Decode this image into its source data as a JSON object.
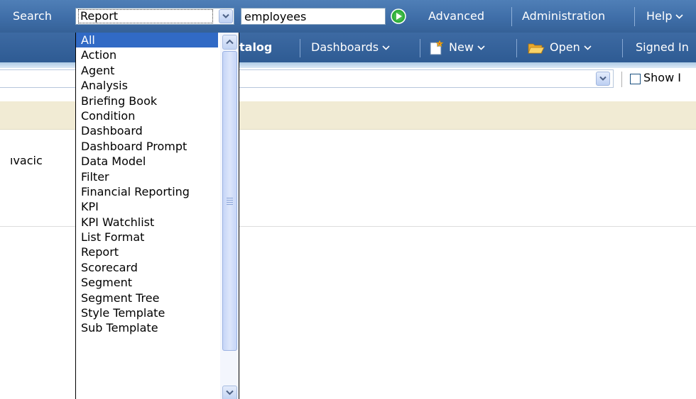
{
  "top_bar": {
    "search_label": "Search",
    "search_type_value": "Report",
    "search_input_value": "employees",
    "search_input_placeholder": "",
    "advanced_label": "Advanced",
    "administration_label": "Administration",
    "help_label": "Help"
  },
  "nav_bar": {
    "catalog_label": "talog",
    "dashboards_label": "Dashboards",
    "new_label": "New",
    "open_label": "Open",
    "signed_in_label": "Signed In"
  },
  "toolbar": {
    "location_value": "",
    "show_label": "Show I",
    "show_checked": false
  },
  "content": {
    "result_name": "ıvacic"
  },
  "dropdown": {
    "selected_index": 0,
    "items": [
      "All",
      "Action",
      "Agent",
      "Analysis",
      "Briefing Book",
      "Condition",
      "Dashboard",
      "Dashboard Prompt",
      "Data Model",
      "Filter",
      "Financial Reporting",
      "KPI",
      "KPI Watchlist",
      "List Format",
      "Report",
      "Scorecard",
      "Segment",
      "Segment Tree",
      "Style Template",
      "Sub Template"
    ],
    "scroll_position_fraction": 0.0,
    "visible_fraction": 0.9
  },
  "colors": {
    "top_bar": "#4274b0",
    "nav_bar": "#35619a",
    "selection": "#316ac5",
    "beige_band": "#f1ebd4",
    "go_icon": "#2eae3a"
  },
  "icons": {
    "search_go": "play-circle-icon",
    "new": "new-document-icon",
    "open": "folder-open-icon",
    "dropdown_arrow": "chevron-down-icon",
    "scroll_up": "chevron-up-icon"
  }
}
